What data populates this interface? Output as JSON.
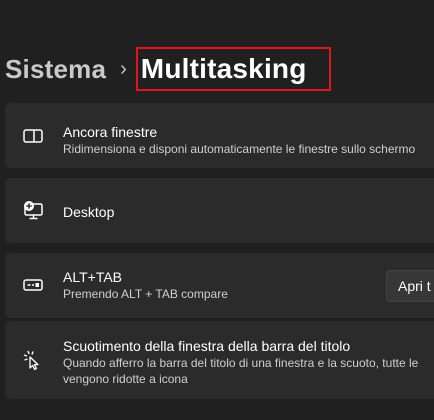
{
  "breadcrumb": {
    "parent": "Sistema",
    "separator": "›",
    "current": "Multitasking"
  },
  "settings": [
    {
      "title": "Ancora finestre",
      "description": "Ridimensiona e disponi automaticamente le finestre sullo schermo",
      "icon": "snap-windows-icon"
    },
    {
      "title": "Desktop",
      "description": "",
      "icon": "desktop-icon"
    },
    {
      "title": "ALT+TAB",
      "description": "Premendo ALT + TAB compare",
      "icon": "alt-tab-icon",
      "action_label": "Apri t"
    },
    {
      "title": "Scuotimento della finestra della barra del titolo",
      "description_line1": "Quando afferro la barra del titolo di una finestra e la scuoto, tutte le",
      "description_line2": "vengono ridotte a icona",
      "icon": "shake-cursor-icon"
    }
  ],
  "colors": {
    "background": "#202020",
    "card": "#2b2b2b",
    "highlight": "#e0141e"
  }
}
